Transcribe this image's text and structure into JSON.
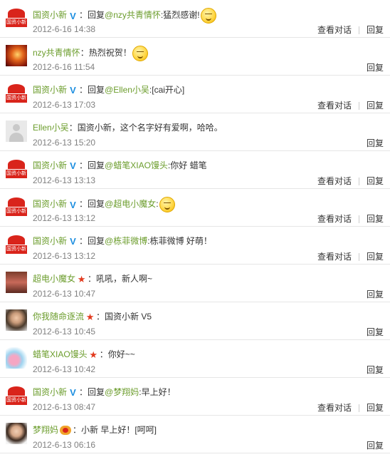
{
  "actions": {
    "view_dialog": "查看对话",
    "reply": "回复"
  },
  "comments": [
    {
      "avatar": "gz",
      "name": "国资小新",
      "badge": "v",
      "reply_prefix": "回复",
      "mention": "@nzy共青情怀",
      "text": ":猛烈感谢!",
      "emoji": true,
      "time": "2012-6-16 14:38",
      "view_dialog": true
    },
    {
      "avatar": "nzy",
      "name": "nzy共青情怀",
      "badge": "",
      "reply_prefix": "",
      "mention": "",
      "text": "：热烈祝贺！",
      "emoji": true,
      "time": "2012-6-16 11:54",
      "view_dialog": false
    },
    {
      "avatar": "gz",
      "name": "国资小新",
      "badge": "v",
      "reply_prefix": "回复",
      "mention": "@Ellen小吴",
      "text": ":[cai开心]",
      "emoji": false,
      "time": "2012-6-13 17:03",
      "view_dialog": true
    },
    {
      "avatar": "ellen",
      "name": "Ellen小吴",
      "badge": "",
      "reply_prefix": "",
      "mention": "",
      "text": "：国资小新，这个名字好有爱啊，哈哈。",
      "emoji": false,
      "time": "2012-6-13 15:20",
      "view_dialog": false
    },
    {
      "avatar": "gz",
      "name": "国资小新",
      "badge": "v",
      "reply_prefix": "回复",
      "mention": "@蜡笔XIAO馒头",
      "text": ":你好 蜡笔",
      "emoji": false,
      "time": "2012-6-13 13:13",
      "view_dialog": true
    },
    {
      "avatar": "gz",
      "name": "国资小新",
      "badge": "v",
      "reply_prefix": "回复",
      "mention": "@超电小魔女",
      "text": ":",
      "emoji": true,
      "time": "2012-6-13 13:12",
      "view_dialog": true
    },
    {
      "avatar": "gz",
      "name": "国资小新",
      "badge": "v",
      "reply_prefix": "回复",
      "mention": "@栋菲微博",
      "text": ":栋菲微博 好萌！",
      "emoji": false,
      "time": "2012-6-13 13:12",
      "view_dialog": true
    },
    {
      "avatar": "cd",
      "name": "超电小魔女",
      "badge": "star",
      "reply_prefix": "",
      "mention": "",
      "text": "：吼吼，新人啊~",
      "emoji": false,
      "time": "2012-6-13 10:47",
      "view_dialog": false
    },
    {
      "avatar": "ni",
      "name": "你我随命逐流",
      "badge": "star",
      "reply_prefix": "",
      "mention": "",
      "text": "：国资小新 V5",
      "emoji": false,
      "time": "2012-6-13 10:45",
      "view_dialog": false
    },
    {
      "avatar": "lb",
      "name": "蜡笔XIAO馒头",
      "badge": "star",
      "reply_prefix": "",
      "mention": "",
      "text": "：你好~~",
      "emoji": false,
      "time": "2012-6-13 10:42",
      "view_dialog": false
    },
    {
      "avatar": "gz",
      "name": "国资小新",
      "badge": "v",
      "reply_prefix": "回复",
      "mention": "@梦翔妈",
      "text": ":早上好！",
      "emoji": false,
      "time": "2012-6-13 08:47",
      "view_dialog": true
    },
    {
      "avatar": "mx",
      "name": "梦翔妈",
      "badge": "vip",
      "reply_prefix": "",
      "mention": "",
      "text": "：小新 早上好！[呵呵]",
      "emoji": false,
      "time": "2012-6-13 06:16",
      "view_dialog": false
    }
  ],
  "logo_text": "国资小新",
  "colors": {
    "name": "#6c9d2d",
    "verified": "#1e8fe0",
    "star": "#e23a1e",
    "logo": "#d9241b",
    "time": "#808080"
  }
}
